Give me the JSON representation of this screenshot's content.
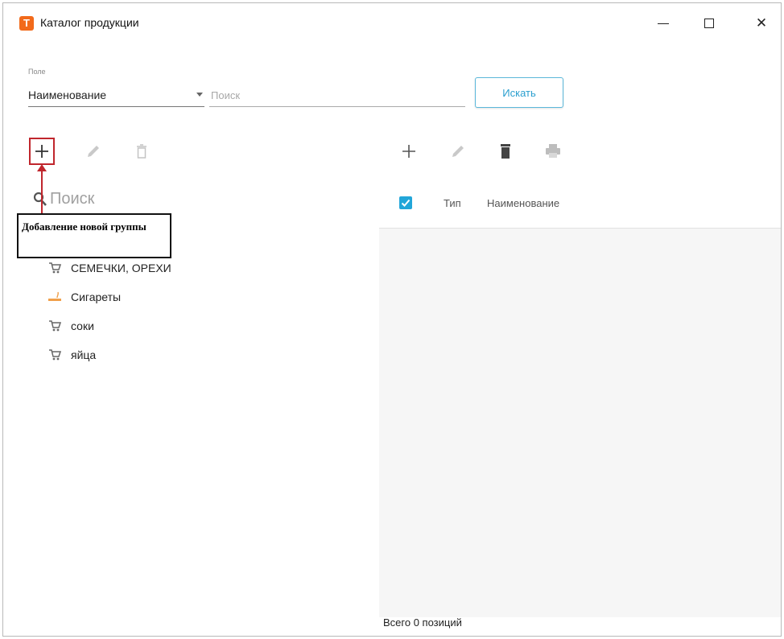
{
  "window": {
    "title": "Каталог продукции",
    "app_icon_letter": "T",
    "accent_color": "#22a6d9",
    "brand_color": "#f26a1b",
    "close_glyph": "✕"
  },
  "search": {
    "field_caption": "Поле",
    "field_value": "Наименование",
    "placeholder": "Поиск",
    "button_label": "Искать"
  },
  "left_toolbar": {
    "icons": [
      "add-icon",
      "edit-icon",
      "delete-icon"
    ]
  },
  "right_toolbar": {
    "icons": [
      "add-icon",
      "edit-icon",
      "delete-icon",
      "print-icon"
    ]
  },
  "tree": {
    "search_label": "Поиск",
    "items": [
      {
        "label": "СЕМЕЧКИ, ОРЕХИ",
        "icon": "cart-icon"
      },
      {
        "label": "Сигареты",
        "icon": "cigarette-icon"
      },
      {
        "label": "соки",
        "icon": "cart-icon"
      },
      {
        "label": "яйца",
        "icon": "cart-icon"
      }
    ]
  },
  "callout": {
    "text": "Добавление новой группы",
    "color": "#c0262d"
  },
  "grid": {
    "columns": [
      "Тип",
      "Наименование"
    ],
    "footer": "Всего 0 позиций"
  }
}
